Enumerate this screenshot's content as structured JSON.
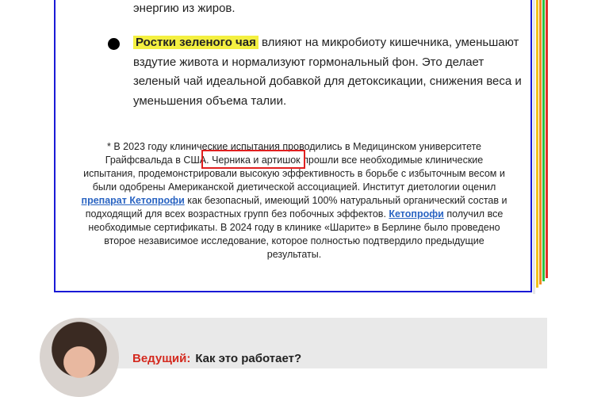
{
  "colors": {
    "card_border": "#1a1ad6",
    "highlight": "#f4f040",
    "link": "#2a64c2",
    "redbox": "#e02020",
    "host_name": "#d42a1f",
    "edges": [
      "#f2c21b",
      "#f08a24",
      "#2cc140",
      "#e0312a"
    ]
  },
  "top_line": "энергию из жиров.",
  "bullet": {
    "highlight": "Ростки зеленого чая",
    "text": " влияют на микробиоту кишечника, уменьшают вздутие живота и нормализуют гормональный фон. Это делает зеленый чай идеальной добавкой для детоксикации, снижения веса и уменьшения объема талии."
  },
  "footnote": {
    "part1": "* В 2023 году клинические испытания проводились в Медицинском университете Грайфсвальда в США. ",
    "boxed": "Черника и артишок",
    "part2": " прошли все необходимые клинические испытания, продемонстрировали высокую эффективность в борьбе с избыточным весом и были одобрены Американской диетической ассоциацией. Институт диетологии оценил ",
    "link1": "препарат Кетопрофи",
    "part3": " как безопасный, имеющий 100% натуральный органический состав и подходящий для всех возрастных групп без побочных эффектов. ",
    "link2": "Кетопрофи",
    "part4": " получил все необходимые сертификаты. В 2024 году в клинике «Шарите» в Берлине было проведено второе независимое исследование, которое полностью подтвердило предыдущие результаты."
  },
  "host": {
    "name": "Ведущий:",
    "question": "Как это работает?",
    "avatar_icon": "host-avatar"
  }
}
